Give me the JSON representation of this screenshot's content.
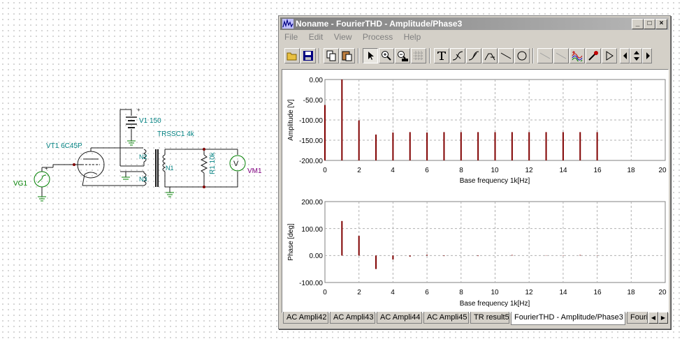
{
  "schematic": {
    "labels": {
      "v1": "V1 150",
      "transformer": "TRSSC1 4k",
      "tube": "VT1 6C45P",
      "n2": "N2",
      "n1": "N1",
      "n3": "N3",
      "r1": "R1 10k",
      "vm1": "VM1",
      "vg1": "VG1",
      "plus": "+",
      "vm_symbol": "V"
    }
  },
  "window": {
    "title": "Noname - FourierTHD - Amplitude/Phase3",
    "buttons": {
      "minimize": "_",
      "maximize": "□",
      "close": "×"
    },
    "menu": [
      "File",
      "Edit",
      "View",
      "Process",
      "Help"
    ]
  },
  "amplitude_plot": {
    "yticks": [
      "0.00",
      "-50.00",
      "-100.00",
      "-150.00",
      "-200.00"
    ],
    "xticks": [
      "0",
      "2",
      "4",
      "6",
      "8",
      "10",
      "12",
      "14",
      "16",
      "18",
      "20"
    ],
    "ylabel": "Amplitude [V]",
    "xlabel": "Base frequency 1k[Hz]"
  },
  "phase_plot": {
    "yticks": [
      "200.00",
      "100.00",
      "0.00",
      "-100.00"
    ],
    "xticks": [
      "0",
      "2",
      "4",
      "6",
      "8",
      "10",
      "12",
      "14",
      "16",
      "18",
      "20"
    ],
    "ylabel": "Phase [deg]",
    "xlabel": "Base frequency 1k[Hz]"
  },
  "chart_data": [
    {
      "type": "bar",
      "xlabel": "Base frequency 1k[Hz]",
      "ylabel": "Amplitude [V]",
      "xlim": [
        0,
        20
      ],
      "ylim": [
        -200,
        0
      ],
      "grid": true,
      "x": [
        0,
        1,
        2,
        3,
        4,
        5,
        6,
        7,
        8,
        9,
        10,
        11,
        12,
        13,
        14,
        15,
        16
      ],
      "values": [
        -63,
        0,
        -101,
        -136,
        -131,
        -130,
        -131,
        -130,
        -130,
        -130,
        -130,
        -130,
        -130,
        -130,
        -130,
        -130,
        -130
      ],
      "color": "#800000"
    },
    {
      "type": "bar",
      "xlabel": "Base frequency 1k[Hz]",
      "ylabel": "Phase [deg]",
      "xlim": [
        0,
        20
      ],
      "ylim": [
        -100,
        200
      ],
      "grid": true,
      "x": [
        1,
        2,
        3,
        4,
        5,
        6,
        7,
        9,
        11,
        13,
        14,
        15,
        16
      ],
      "values": [
        128,
        73,
        -50,
        -15,
        -4,
        3,
        -2,
        -2,
        2,
        1,
        -1,
        2,
        1
      ],
      "color": "#800000"
    }
  ],
  "tabs": [
    {
      "label": "AC Ampli42",
      "active": false
    },
    {
      "label": "AC Ampli43",
      "active": false
    },
    {
      "label": "AC Ampli44",
      "active": false
    },
    {
      "label": "AC Ampli45",
      "active": false
    },
    {
      "label": "TR result5",
      "active": false
    },
    {
      "label": "FourierTHD - Amplitude/Phase3",
      "active": true
    },
    {
      "label": "Fourie",
      "active": false
    }
  ],
  "tab_scroll": {
    "left": "◀",
    "right": "▶"
  },
  "colors": {
    "bar": "#800000",
    "schematic_wire": "#1a1a1a",
    "schematic_text": "#008080",
    "titlebar": "#7e7e7e"
  }
}
